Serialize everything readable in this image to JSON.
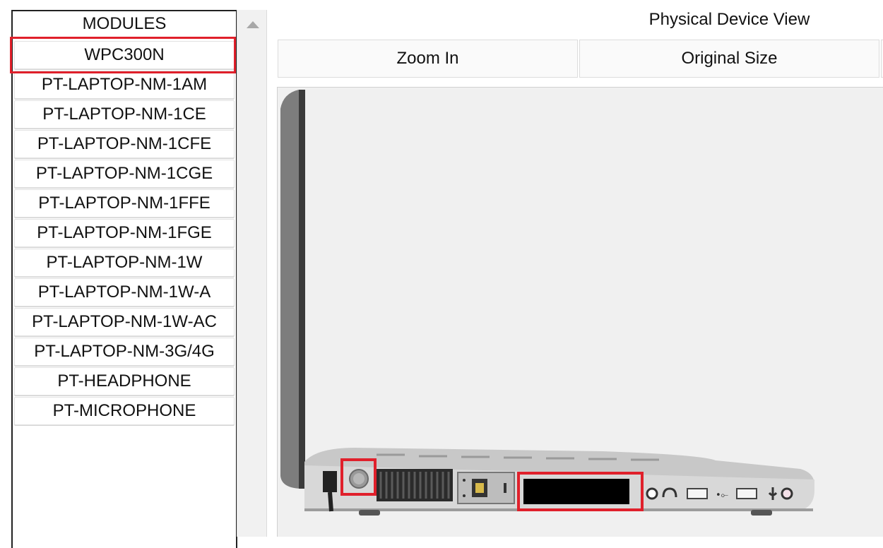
{
  "modules": {
    "header": "MODULES",
    "items": [
      {
        "label": "WPC300N",
        "selected": true
      },
      {
        "label": "PT-LAPTOP-NM-1AM"
      },
      {
        "label": "PT-LAPTOP-NM-1CE"
      },
      {
        "label": "PT-LAPTOP-NM-1CFE"
      },
      {
        "label": "PT-LAPTOP-NM-1CGE"
      },
      {
        "label": "PT-LAPTOP-NM-1FFE"
      },
      {
        "label": "PT-LAPTOP-NM-1FGE"
      },
      {
        "label": "PT-LAPTOP-NM-1W"
      },
      {
        "label": "PT-LAPTOP-NM-1W-A"
      },
      {
        "label": "PT-LAPTOP-NM-1W-AC"
      },
      {
        "label": "PT-LAPTOP-NM-3G/4G"
      },
      {
        "label": "PT-HEADPHONE"
      },
      {
        "label": "PT-MICROPHONE"
      }
    ]
  },
  "view": {
    "title": "Physical Device View",
    "zoom_in_label": "Zoom In",
    "original_size_label": "Original Size"
  },
  "device": {
    "name": "laptop-side-view",
    "highlight_color": "#e0202b",
    "ports": [
      "power-jack",
      "power-button",
      "vent",
      "ethernet-port",
      "module-slot",
      "audio-out",
      "headphone-jack",
      "usb-port",
      "usb-port",
      "microphone-jack",
      "audio-in"
    ]
  }
}
